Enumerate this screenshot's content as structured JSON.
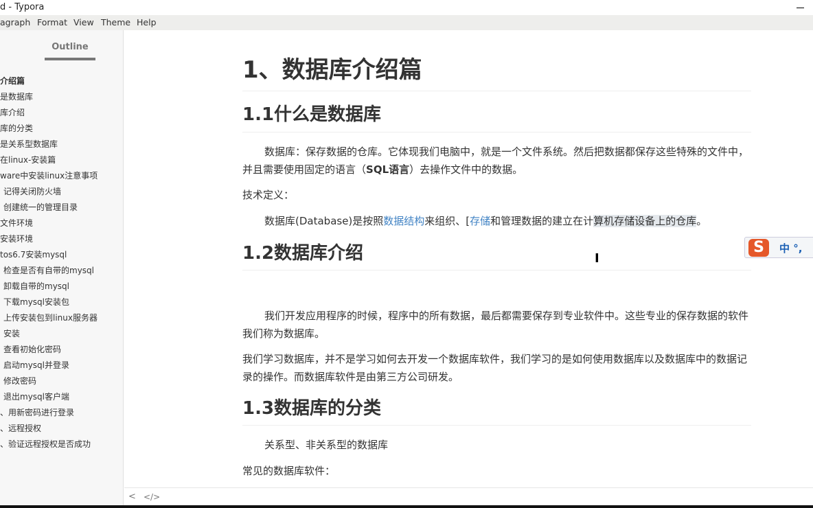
{
  "window": {
    "title": "d - Typora"
  },
  "menu": [
    "agraph",
    "Format",
    "View",
    "Theme",
    "Help"
  ],
  "sidebar": {
    "title": "Outline",
    "items": [
      "介绍篇",
      "是数据库",
      "库介绍",
      "库的分类",
      "是关系型数据库",
      "在linux-安装篇",
      "ware中安装linux注意事项",
      "记得关闭防火墙",
      "创建统一的管理目录",
      "文件环境",
      "安装环境",
      "tos6.7安装mysql",
      "检查是否有自带的mysql",
      "卸载自带的mysql",
      "下载mysql安装包",
      "上传安装包到linux服务器",
      "安装",
      "查看初始化密码",
      "启动mysql并登录",
      "修改密码",
      "退出mysql客户端",
      "、用新密码进行登录",
      "、远程授权",
      "、验证远程授权是否成功"
    ]
  },
  "doc": {
    "h1": "1、数据库介绍篇",
    "h2_1": "1.1什么是数据库",
    "p1a": "数据库：保存数据的仓库。它体现我们电脑中，就是一个文件系统。然后把数据都保存这些特殊的文件中，并且需要使用固定的语言（",
    "p1b": "SQL语言",
    "p1c": "）去操作文件中的数据。",
    "p2": "技术定义：",
    "p3a": "数据库(Database)是按照",
    "p3link1": "数据结构",
    "p3b": "来组织、[",
    "p3link2": "存储",
    "p3c": "和管理数据的建立在计",
    "p3hl": "算机存储设备上的仓库",
    "p3d": "。",
    "h2_2": "1.2数据库介绍",
    "p4": "我们开发应用程序的时候，程序中的所有数据，最后都需要保存到专业软件中。这些专业的保存数据的软件我们称为数据库。",
    "p5": "我们学习数据库，并不是学习如何去开发一个数据库软件，我们学习的是如何使用数据库以及数据库中的数据记录的操作。而数据库软件是由第三方公司研发。",
    "h2_3": "1.3数据库的分类",
    "p6": "关系型、非关系型的数据库",
    "p7": "常见的数据库软件："
  },
  "footer": {
    "toggle": "<",
    "source": "</>"
  },
  "ime": {
    "logo": "S",
    "text": "中 °,"
  }
}
